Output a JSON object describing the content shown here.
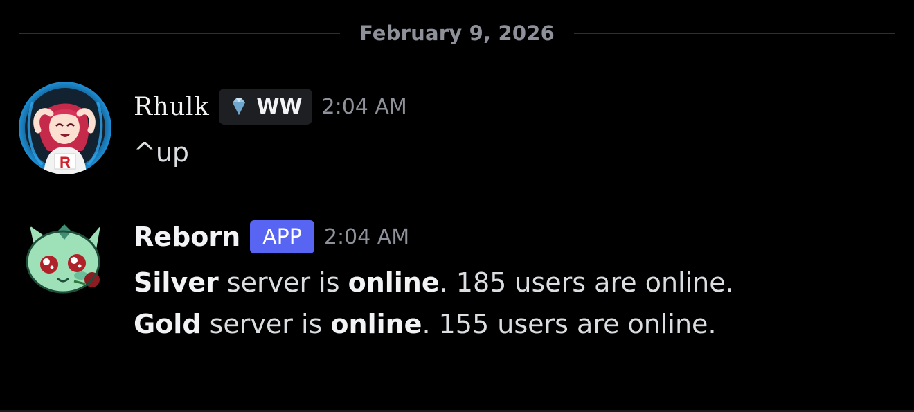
{
  "date_divider": "February 9, 2026",
  "messages": [
    {
      "username": "Rhulk",
      "tag": {
        "icon": "diamond-icon",
        "label": "WW"
      },
      "timestamp": "2:04 AM",
      "content": "^up"
    },
    {
      "username": "Reborn",
      "badge": "APP",
      "timestamp": "2:04 AM",
      "lines": [
        {
          "bold1": "Silver",
          "text1": " server is ",
          "bold2": "online",
          "text2": ". 185 users are online."
        },
        {
          "bold1": "Gold",
          "text1": " server is ",
          "bold2": "online",
          "text2": ". 155 users are online."
        }
      ]
    }
  ],
  "colors": {
    "background": "#000000",
    "app_badge": "#5865f2",
    "muted_text": "#8e9199",
    "divider": "#2e2f34"
  }
}
